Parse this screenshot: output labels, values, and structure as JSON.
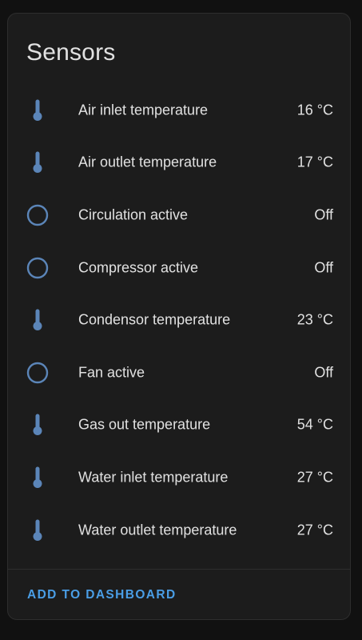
{
  "card": {
    "title": "Sensors",
    "action_label": "ADD TO DASHBOARD"
  },
  "colors": {
    "icon": "#5b85b8",
    "accent": "#4a9ee6",
    "text": "#e1e1e1",
    "card_bg": "#1c1c1c",
    "page_bg": "#111111"
  },
  "sensors": [
    {
      "icon": "thermometer-icon",
      "label": "Air inlet temperature",
      "value": "16 °C"
    },
    {
      "icon": "thermometer-icon",
      "label": "Air outlet temperature",
      "value": "17 °C"
    },
    {
      "icon": "circle-outline-icon",
      "label": "Circulation active",
      "value": "Off"
    },
    {
      "icon": "circle-outline-icon",
      "label": "Compressor active",
      "value": "Off"
    },
    {
      "icon": "thermometer-icon",
      "label": "Condensor temperature",
      "value": "23 °C"
    },
    {
      "icon": "circle-outline-icon",
      "label": "Fan active",
      "value": "Off"
    },
    {
      "icon": "thermometer-icon",
      "label": "Gas out temperature",
      "value": "54 °C"
    },
    {
      "icon": "thermometer-icon",
      "label": "Water inlet temperature",
      "value": "27 °C"
    },
    {
      "icon": "thermometer-icon",
      "label": "Water outlet temperature",
      "value": "27 °C"
    }
  ]
}
